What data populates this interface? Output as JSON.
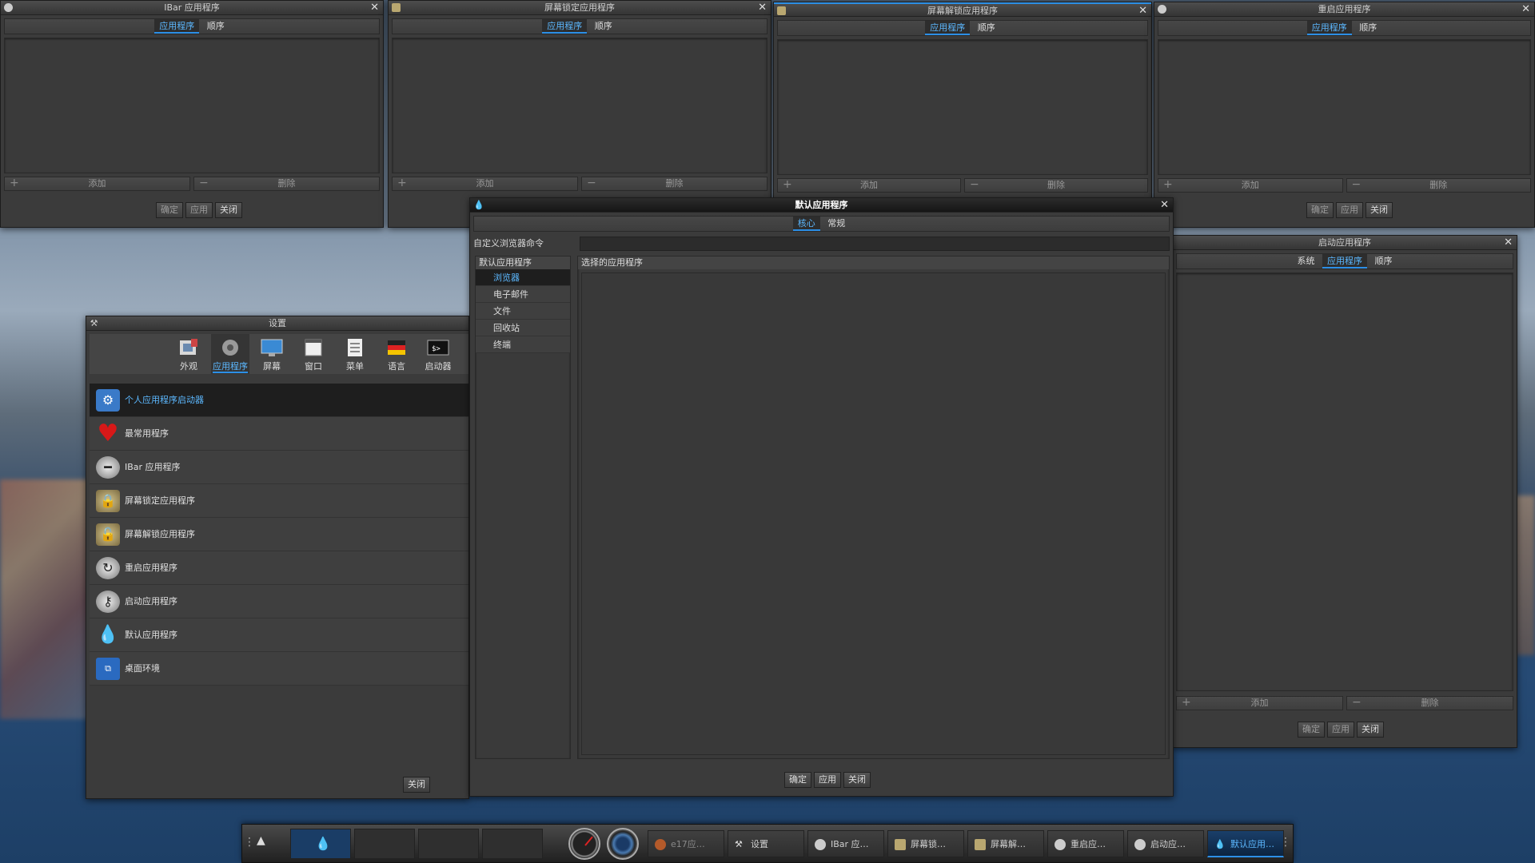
{
  "windows": {
    "ibar": {
      "title": "IBar 应用程序",
      "tabs": [
        "应用程序",
        "顺序"
      ],
      "add": "添加",
      "remove": "删除",
      "ok": "确定",
      "apply": "应用",
      "close": "关闭"
    },
    "screenlock": {
      "title": "屏幕锁定应用程序",
      "tabs": [
        "应用程序",
        "顺序"
      ],
      "add": "添加",
      "remove": "删除"
    },
    "screenunlock": {
      "title": "屏幕解锁应用程序",
      "tabs": [
        "应用程序",
        "顺序"
      ],
      "add": "添加",
      "remove": "删除"
    },
    "restart": {
      "title": "重启应用程序",
      "tabs": [
        "应用程序",
        "顺序"
      ],
      "add": "添加",
      "remove": "删除",
      "ok": "确定",
      "apply": "应用",
      "close": "关闭"
    },
    "startup": {
      "title": "启动应用程序",
      "tabs": [
        "系统",
        "应用程序",
        "顺序"
      ],
      "add": "添加",
      "remove": "删除",
      "ok": "确定",
      "apply": "应用",
      "close": "关闭"
    },
    "settings": {
      "title": "设置",
      "categories": [
        "外观",
        "应用程序",
        "屏幕",
        "窗口",
        "菜单",
        "语言",
        "启动器"
      ],
      "items": [
        "个人应用程序启动器",
        "最常用程序",
        "IBar 应用程序",
        "屏幕锁定应用程序",
        "屏幕解锁应用程序",
        "重启应用程序",
        "启动应用程序",
        "默认应用程序",
        "桌面环境"
      ],
      "close": "关闭"
    },
    "defaultapps": {
      "title": "默认应用程序",
      "tabs": [
        "核心",
        "常规"
      ],
      "custom_browser_label": "自定义浏览器命令",
      "left_header": "默认应用程序",
      "right_header": "选择的应用程序",
      "tree": [
        "浏览器",
        "电子邮件",
        "文件",
        "回收站",
        "终端"
      ],
      "ok": "确定",
      "apply": "应用",
      "close": "关闭"
    }
  },
  "taskbar": {
    "tasks": [
      "e17应…",
      "设置",
      "IBar 应…",
      "屏幕锁…",
      "屏幕解…",
      "重启应…",
      "启动应…",
      "默认应用…"
    ]
  }
}
